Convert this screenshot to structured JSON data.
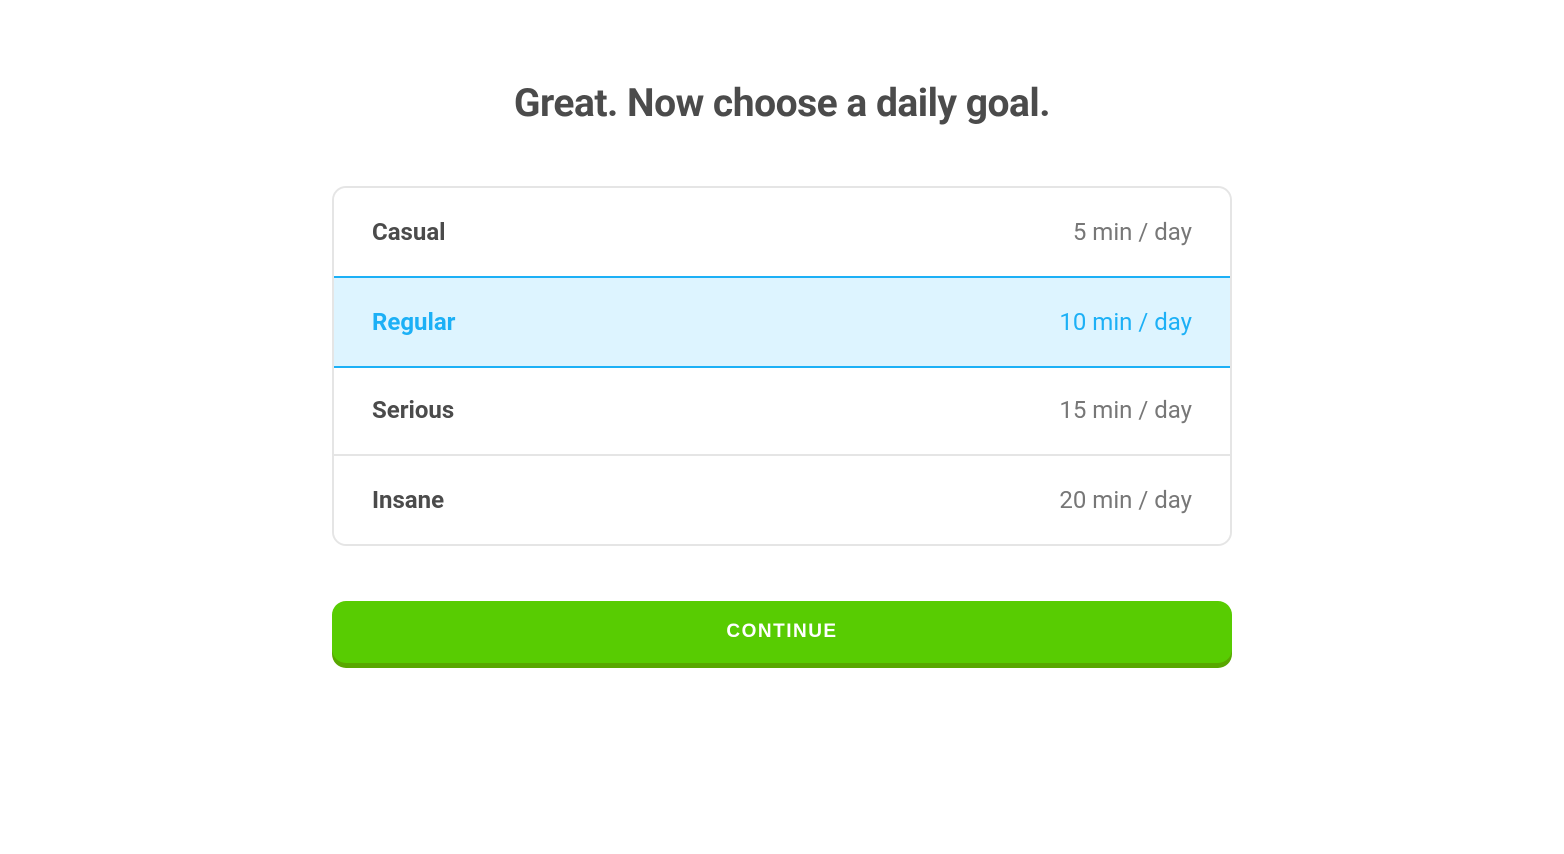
{
  "title": "Great. Now choose a daily goal.",
  "goals": [
    {
      "name": "Casual",
      "duration": "5 min / day",
      "selected": false
    },
    {
      "name": "Regular",
      "duration": "10 min / day",
      "selected": true
    },
    {
      "name": "Serious",
      "duration": "15 min / day",
      "selected": false
    },
    {
      "name": "Insane",
      "duration": "20 min / day",
      "selected": false
    }
  ],
  "continue_label": "CONTINUE"
}
